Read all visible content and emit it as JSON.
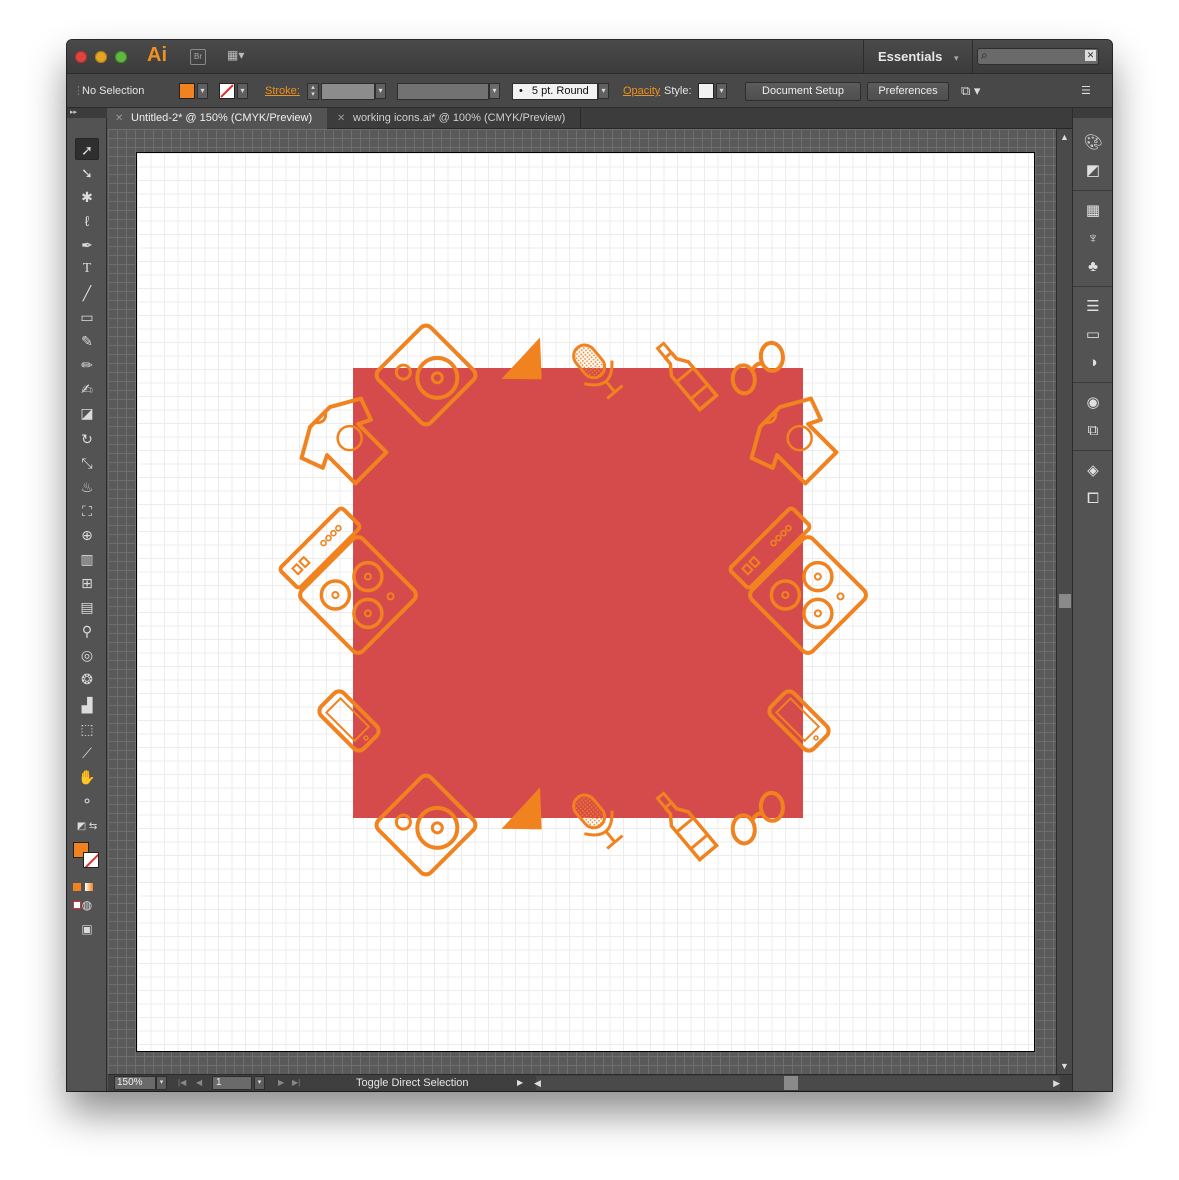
{
  "app": {
    "logo": "Ai",
    "bridge_button": "Br",
    "workspace": "Essentials",
    "search": {
      "placeholder": "",
      "value": ""
    }
  },
  "control_bar": {
    "selection": "No Selection",
    "stroke_label": "Stroke:",
    "brush": "5 pt. Round",
    "opacity_label": "Opacity",
    "style_label": "Style:",
    "document_setup": "Document Setup",
    "preferences": "Preferences",
    "fill_color": "#f0821f"
  },
  "tabs": [
    {
      "label": "Untitled-2* @ 150% (CMYK/Preview)",
      "active": true
    },
    {
      "label": "working icons.ai* @ 100% (CMYK/Preview)",
      "active": false
    }
  ],
  "status_bar": {
    "zoom": "150%",
    "page": "1",
    "status": "Toggle Direct Selection"
  },
  "artwork": {
    "rectangle_color": "#d54b4b",
    "icon_color": "#f0821f",
    "icons": [
      "speaker",
      "pennant",
      "microphone",
      "bottle",
      "sunglasses",
      "t-shirt",
      "cassette",
      "boombox",
      "phone"
    ]
  },
  "tools": [
    "selection-tool",
    "direct-selection-tool",
    "magic-wand-tool",
    "lasso-tool",
    "pen-tool",
    "type-tool",
    "line-tool",
    "rectangle-tool",
    "paintbrush-tool",
    "pencil-tool",
    "blob-brush-tool",
    "eraser-tool",
    "rotate-tool",
    "scale-tool",
    "warp-tool",
    "free-transform-tool",
    "shape-builder-tool",
    "perspective-grid-tool",
    "mesh-tool",
    "gradient-tool",
    "eyedropper-tool",
    "blend-tool",
    "symbol-sprayer-tool",
    "graph-tool",
    "artboard-tool",
    "slice-tool",
    "hand-tool",
    "zoom-tool"
  ]
}
